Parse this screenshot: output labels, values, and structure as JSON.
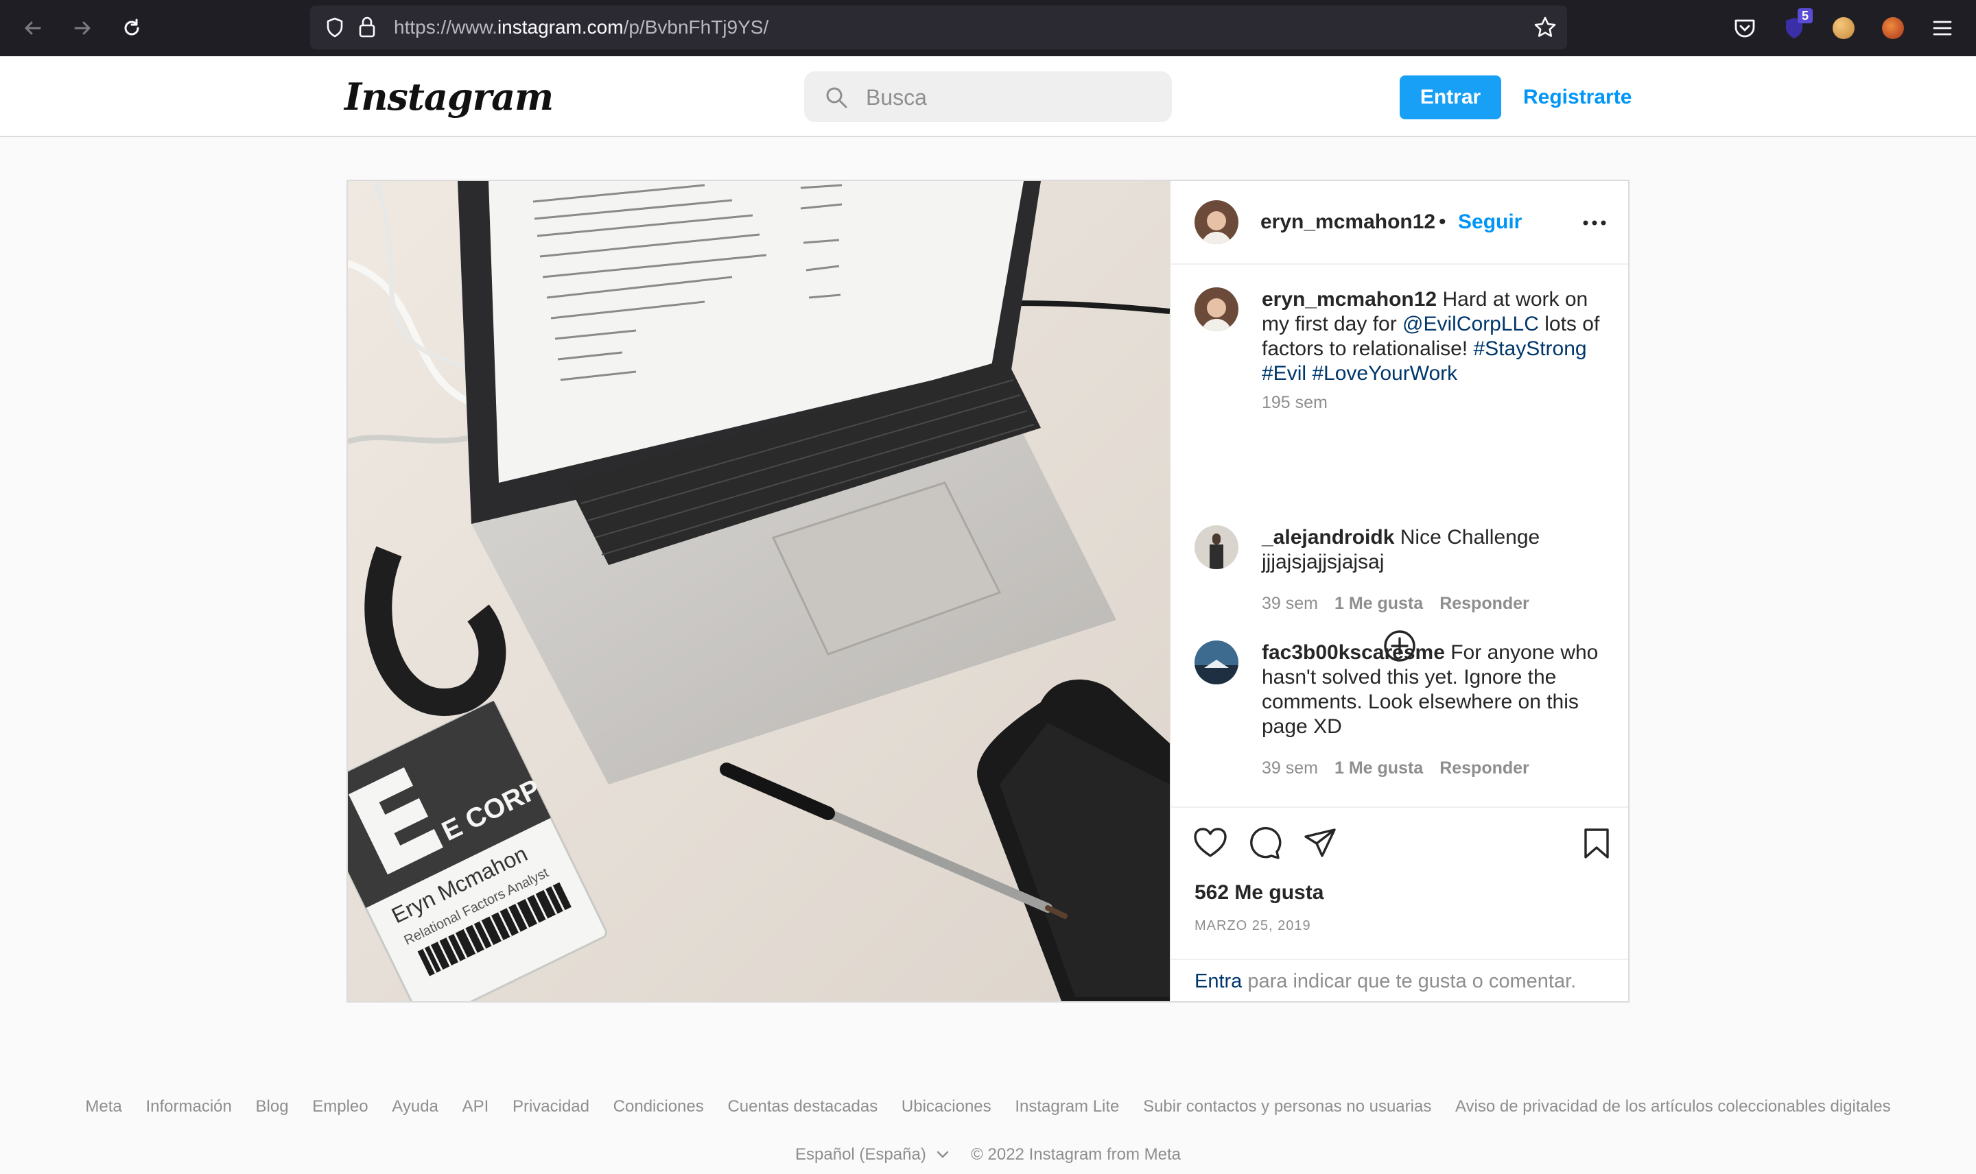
{
  "browser": {
    "url_prefix": "https://www.",
    "url_host": "instagram.com",
    "url_path": "/p/BvbnFhTj9YS/",
    "extension_badge": "5"
  },
  "header": {
    "logo_text": "Instagram",
    "search_placeholder": "Busca",
    "login_label": "Entrar",
    "signup_label": "Registrarte"
  },
  "post": {
    "author": "eryn_mcmahon12",
    "follow_label": "Seguir",
    "caption": {
      "user": "eryn_mcmahon12",
      "text_1": "Hard at work on my first day for",
      "mention": "@EvilCorpLLC",
      "text_2": "lots of factors to relationalise!",
      "tag_1": "#StayStrong",
      "tag_2": "#Evil",
      "tag_3": "#LoveYourWork",
      "age": "195 sem"
    },
    "comments": [
      {
        "user": "_alejandroidk",
        "text": "Nice Challenge jjjajsjajjsjajsaj",
        "age": "39 sem",
        "likes": "1 Me gusta",
        "reply": "Responder"
      },
      {
        "user": "fac3b00kscaresme",
        "text": "For anyone who hasn't solved this yet. Ignore the comments. Look elsewhere on this page XD",
        "age": "39 sem",
        "likes": "1 Me gusta",
        "reply": "Responder"
      }
    ],
    "likes": "562 Me gusta",
    "date": "MARZO 25, 2019",
    "login_prompt_link": "Entra",
    "login_prompt_text": "para indicar que te gusta o comentar."
  },
  "photo_text": {
    "badge_brand": "E CORP",
    "badge_name": "Eryn Mcmahon",
    "badge_title": "Relational Factors Analyst"
  },
  "footer": {
    "links": [
      "Meta",
      "Información",
      "Blog",
      "Empleo",
      "Ayuda",
      "API",
      "Privacidad",
      "Condiciones",
      "Cuentas destacadas",
      "Ubicaciones",
      "Instagram Lite",
      "Subir contactos y personas no usuarias",
      "Aviso de privacidad de los artículos coleccionables digitales"
    ],
    "language": "Español (España)",
    "copyright": "© 2022 Instagram from Meta"
  },
  "colors": {
    "accent": "#0095f6",
    "link_dark": "#00376b",
    "muted": "#8e8e8e",
    "browser_bg": "#1f1e25"
  }
}
